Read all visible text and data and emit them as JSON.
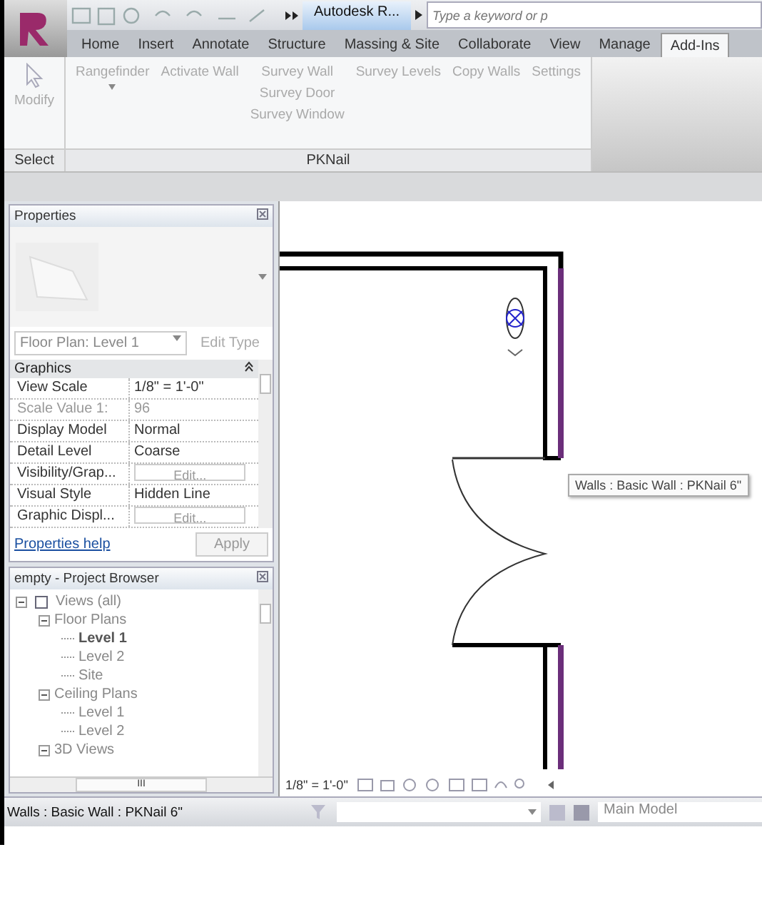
{
  "app": {
    "title": "Autodesk R...",
    "search_placeholder": "Type a keyword or p"
  },
  "tabs": [
    {
      "label": "Home",
      "selected": false
    },
    {
      "label": "Insert",
      "selected": false
    },
    {
      "label": "Annotate",
      "selected": false
    },
    {
      "label": "Structure",
      "selected": false
    },
    {
      "label": "Massing & Site",
      "selected": false
    },
    {
      "label": "Collaborate",
      "selected": false
    },
    {
      "label": "View",
      "selected": false
    },
    {
      "label": "Manage",
      "selected": false
    },
    {
      "label": "Add-Ins",
      "selected": true
    }
  ],
  "ribbon": {
    "panels": [
      {
        "title": "Select",
        "columns": [
          [
            "Modify"
          ]
        ]
      },
      {
        "title": "PKNail",
        "columns": [
          [
            "Rangefinder"
          ],
          [
            "Activate Wall"
          ],
          [
            "Survey Wall",
            "Survey Door",
            "Survey Window"
          ],
          [
            "Survey Levels"
          ],
          [
            "Copy Walls"
          ],
          [
            "Settings"
          ]
        ]
      }
    ]
  },
  "properties": {
    "title": "Properties",
    "type_selector": "Floor Plan: Level 1",
    "edit_type": "Edit Type",
    "group": "Graphics",
    "rows": [
      {
        "label": "View Scale",
        "kind": "text",
        "value": "1/8\" = 1'-0\"",
        "disabled": false
      },
      {
        "label": "Scale Value  1:",
        "kind": "text",
        "value": "96",
        "disabled": true
      },
      {
        "label": "Display Model",
        "kind": "text",
        "value": "Normal",
        "disabled": false
      },
      {
        "label": "Detail Level",
        "kind": "text",
        "value": "Coarse",
        "disabled": false
      },
      {
        "label": "Visibility/Grap...",
        "kind": "button",
        "value": "Edit...",
        "disabled": false
      },
      {
        "label": "Visual Style",
        "kind": "text",
        "value": "Hidden Line",
        "disabled": false
      },
      {
        "label": "Graphic Displ...",
        "kind": "button",
        "value": "Edit...",
        "disabled": false
      }
    ],
    "help": "Properties help",
    "apply": "Apply"
  },
  "browser": {
    "title": "empty - Project Browser",
    "tree": [
      {
        "label": "Views (all)",
        "expanded": true,
        "selected": false,
        "children": [
          {
            "label": "Floor Plans",
            "expanded": true,
            "selected": false,
            "children": [
              {
                "label": "Level 1",
                "selected": true
              },
              {
                "label": "Level 2",
                "selected": false
              },
              {
                "label": "Site",
                "selected": false
              }
            ]
          },
          {
            "label": "Ceiling Plans",
            "expanded": true,
            "selected": false,
            "children": [
              {
                "label": "Level 1",
                "selected": false
              },
              {
                "label": "Level 2",
                "selected": false
              }
            ]
          },
          {
            "label": "3D Views",
            "expanded": true,
            "selected": false
          }
        ]
      }
    ],
    "hscroll": "III"
  },
  "canvas": {
    "tooltip": "Walls : Basic Wall : PKNail 6\"",
    "scale": "1/8\" = 1'-0\""
  },
  "status_bar": {
    "text": "Walls : Basic Wall : PKNail 6\"",
    "workset": "Main Model"
  }
}
